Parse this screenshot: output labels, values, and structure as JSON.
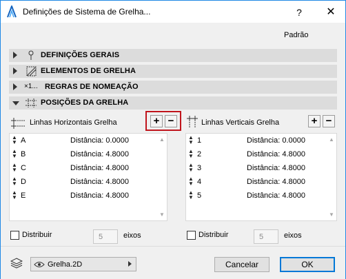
{
  "window": {
    "title": "Definições de Sistema de Grelha...",
    "help_label": "?",
    "close_label": "✕"
  },
  "preset_label": "Padrão",
  "sections": [
    {
      "label": "DEFINIÇÕES GERAIS",
      "icon": "pin-icon",
      "expanded": false
    },
    {
      "label": "ELEMENTOS DE GRELHA",
      "icon": "grid-element-icon",
      "expanded": false
    },
    {
      "label": "REGRAS DE NOMEAÇÃO",
      "icon": "naming-rule-icon",
      "icon_text": "×1...",
      "expanded": false
    },
    {
      "label": "POSIÇÕES DA GRELHA",
      "icon": "grid-positions-icon",
      "expanded": true
    }
  ],
  "horizontal": {
    "label": "Linhas Horizontais Grelha",
    "add_label": "+",
    "remove_label": "−",
    "rows": [
      {
        "name": "A",
        "distance": "Distância: 0.0000"
      },
      {
        "name": "B",
        "distance": "Distância: 4.8000"
      },
      {
        "name": "C",
        "distance": "Distância: 4.8000"
      },
      {
        "name": "D",
        "distance": "Distância: 4.8000"
      },
      {
        "name": "E",
        "distance": "Distância: 4.8000"
      }
    ],
    "distribute_label": "Distribuir",
    "distribute_checked": false,
    "axes_value": "5",
    "axes_unit": "eixos"
  },
  "vertical": {
    "label": "Linhas Verticais Grelha",
    "add_label": "+",
    "remove_label": "−",
    "rows": [
      {
        "name": "1",
        "distance": "Distância: 0.0000"
      },
      {
        "name": "2",
        "distance": "Distância: 4.8000"
      },
      {
        "name": "3",
        "distance": "Distância: 4.8000"
      },
      {
        "name": "4",
        "distance": "Distância: 4.8000"
      },
      {
        "name": "5",
        "distance": "Distância: 4.8000"
      }
    ],
    "distribute_label": "Distribuir",
    "distribute_checked": false,
    "axes_value": "5",
    "axes_unit": "eixos"
  },
  "footer": {
    "layer_name": "Grelha.2D",
    "cancel_label": "Cancelar",
    "ok_label": "OK"
  },
  "colors": {
    "window_border": "#1e88e5",
    "highlight": "#c0141c",
    "section_bg": "#dcdcdc"
  }
}
